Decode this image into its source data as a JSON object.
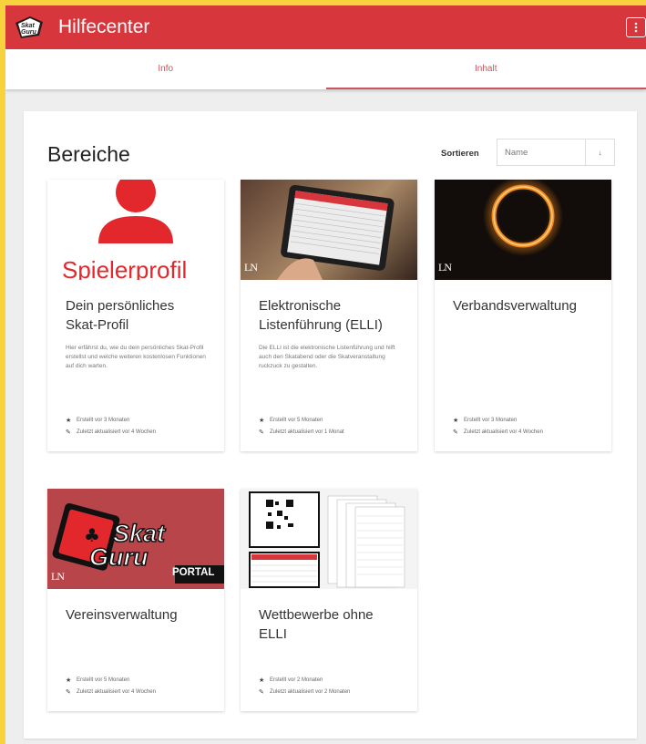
{
  "header": {
    "title": "Hilfecenter",
    "logo_text": "Skat Guru",
    "menu_icon": "more-vertical-icon"
  },
  "tabs": [
    {
      "label": "Info",
      "active": false
    },
    {
      "label": "Inhalt",
      "active": true
    }
  ],
  "main": {
    "section_title": "Bereiche",
    "sort": {
      "label": "Sortieren",
      "value": "Name",
      "arrow": "↓"
    }
  },
  "tiles": [
    {
      "title_line1": "Dein persönliches",
      "title_line2": "Skat-Profil",
      "image_text": "Spielerprofil",
      "description": "Hier erfährst du, wie du dein persönliches Skat-Profil erstellst und welche weiteren kostenlosen Funktionen auf dich warten.",
      "created": "Erstellt vor 3 Monaten",
      "updated": "Zuletzt aktualisiert vor 4 Wochen"
    },
    {
      "title_line1": "Elektronische",
      "title_line2": "Listenführung (ELLI)",
      "image_text": "",
      "description": "Die ELLI ist die elektronische Listenführung und hilft auch den Skatabend oder die Skatveranstaltung ruckzuck zu gestalten.",
      "created": "Erstellt vor 5 Monaten",
      "updated": "Zuletzt aktualisiert vor 1 Monat"
    },
    {
      "title_line1": "Verbandsverwaltung",
      "title_line2": "",
      "image_text": "",
      "description": "",
      "created": "Erstellt vor 3 Monaten",
      "updated": "Zuletzt aktualisiert vor 4 Wochen"
    },
    {
      "title_line1": "Vereinsverwaltung",
      "title_line2": "",
      "image_text_1": "Skat",
      "image_text_2": "Guru",
      "image_text_3": "PORTAL",
      "description": "",
      "created": "Erstellt vor 5 Monaten",
      "updated": "Zuletzt aktualisiert vor 4 Wochen"
    },
    {
      "title_line1": "Wettbewerbe ohne",
      "title_line2": "ELLI",
      "image_text": "",
      "description": "",
      "created": "Erstellt vor 2 Monaten",
      "updated": "Zuletzt aktualisiert vor 2 Monaten"
    }
  ],
  "colors": {
    "brand_red": "#d6363c",
    "frame_yellow": "#f7d23c",
    "tab_accent": "#c9545a"
  }
}
